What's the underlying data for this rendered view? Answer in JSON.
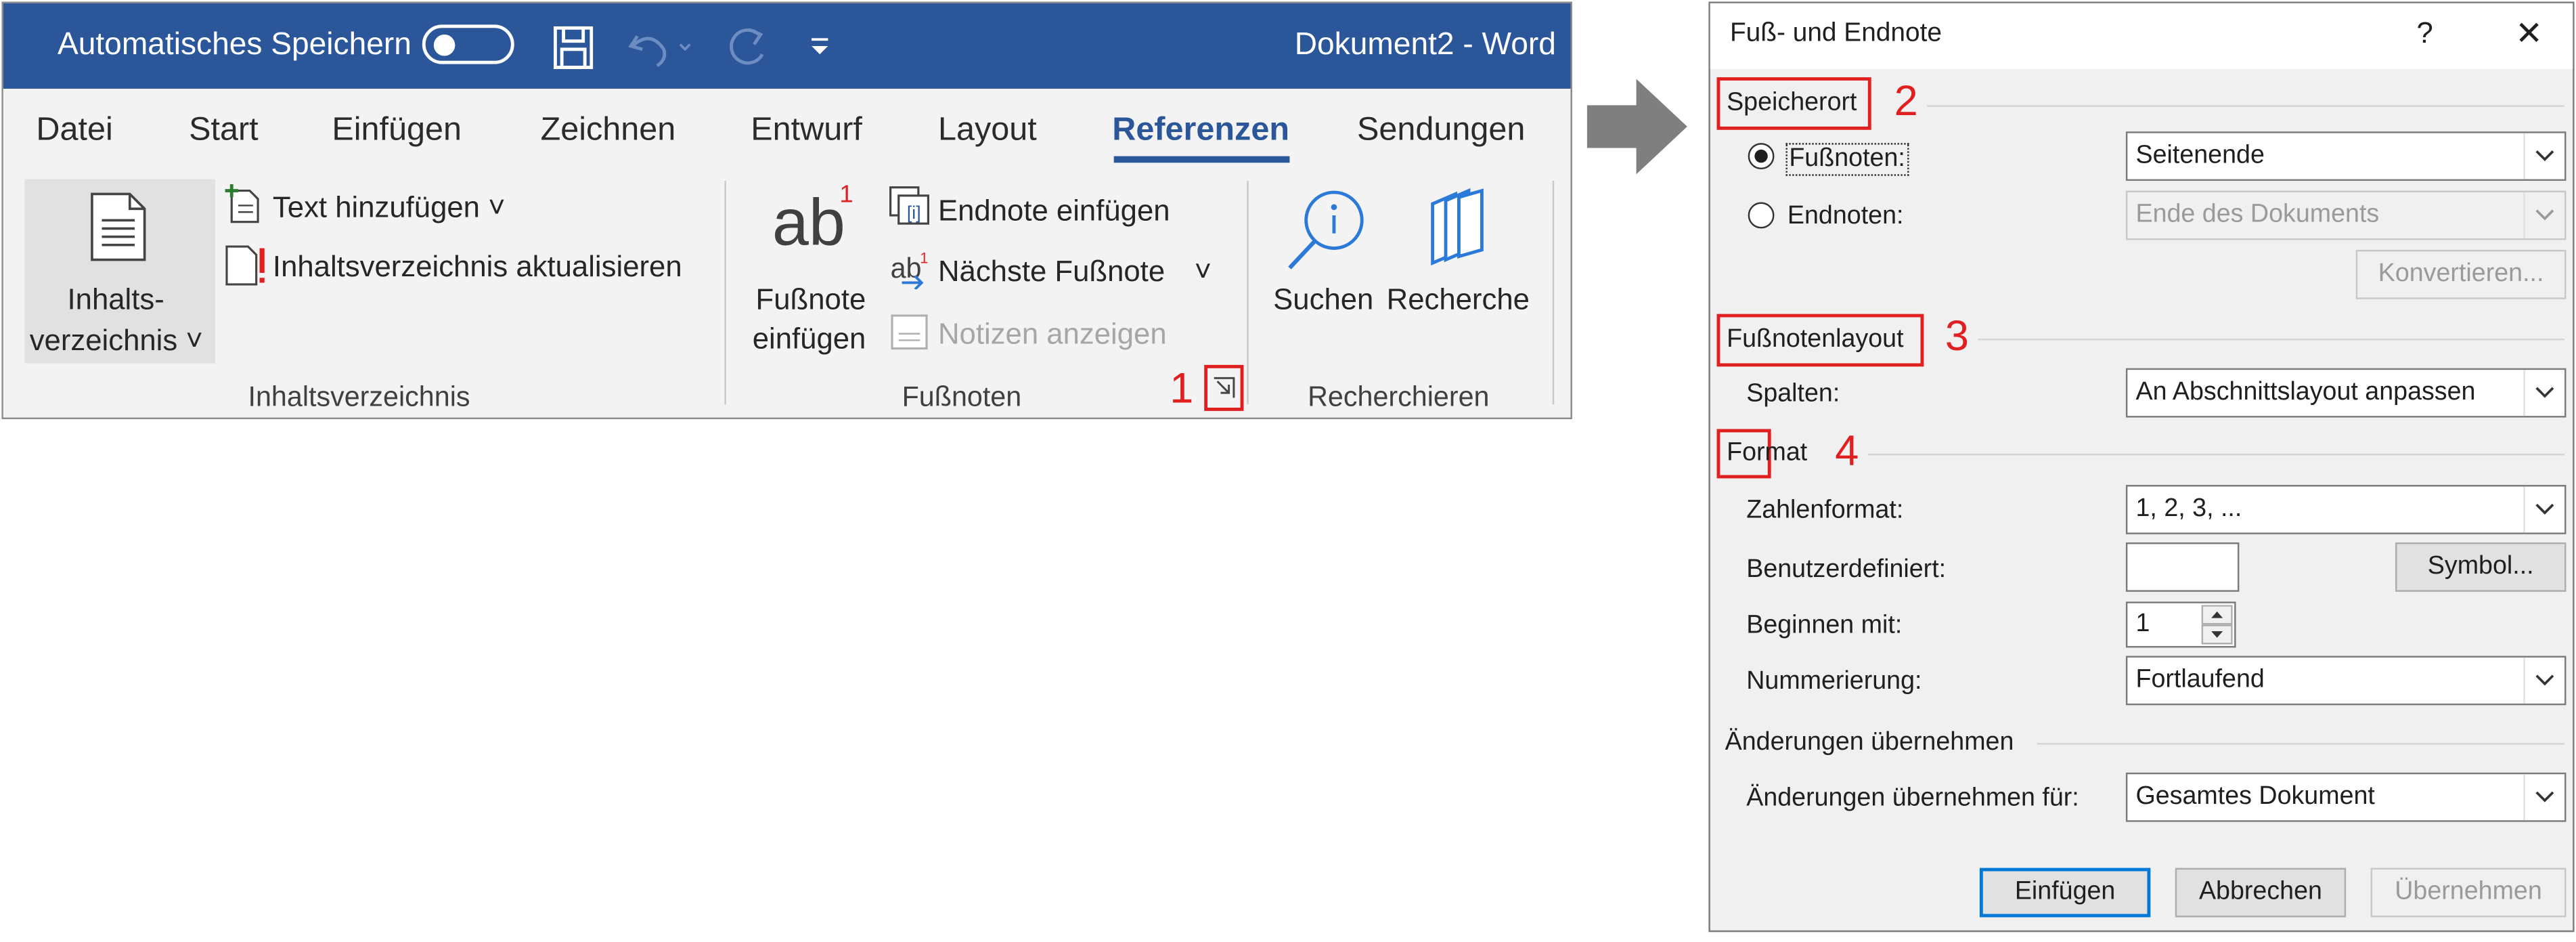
{
  "word": {
    "title_autosave": "Automatisches Speichern",
    "doc_title": "Dokument2  -  Word",
    "tabs": [
      "Datei",
      "Start",
      "Einfügen",
      "Zeichnen",
      "Entwurf",
      "Layout",
      "Referenzen",
      "Sendungen"
    ],
    "selected_tab": "Referenzen",
    "toc": {
      "button_line1": "Inhalts-",
      "button_line2": "verzeichnis ˅",
      "add_text": "Text hinzufügen ˅",
      "update_toc": "Inhaltsverzeichnis aktualisieren",
      "group_label": "Inhaltsverzeichnis"
    },
    "footnotes": {
      "insert_line1": "Fußnote",
      "insert_line2": "einfügen",
      "icon_text": "ab",
      "icon_superscript": "1",
      "insert_endnote": "Endnote einfügen",
      "next_footnote": "Nächste Fußnote",
      "next_chevron": "˅",
      "show_notes": "Notizen anzeigen",
      "group_label": "Fußnoten",
      "marker": "1"
    },
    "research": {
      "search": "Suchen",
      "researcher": "Recherche",
      "group_label": "Recherchieren"
    }
  },
  "dialog": {
    "title": "Fuß- und Endnote",
    "help": "?",
    "close": "✕",
    "location": {
      "heading": "Speicherort",
      "marker": "2",
      "footnotes_label": "Fußnoten:",
      "footnotes_value": "Seitenende",
      "endnotes_label": "Endnoten:",
      "endnotes_value": "Ende des Dokuments",
      "convert_button": "Konvertieren...",
      "selected": "footnotes"
    },
    "layout": {
      "heading": "Fußnotenlayout",
      "marker": "3",
      "columns_label": "Spalten:",
      "columns_value": "An Abschnittslayout anpassen"
    },
    "format": {
      "heading": "Format",
      "marker": "4",
      "number_format_label": "Zahlenformat:",
      "number_format_value": "1, 2, 3, ...",
      "custom_label": "Benutzerdefiniert:",
      "custom_value": "",
      "symbol_button": "Symbol...",
      "start_label": "Beginnen mit:",
      "start_value": "1",
      "numbering_label": "Nummerierung:",
      "numbering_value": "Fortlaufend"
    },
    "apply": {
      "heading": "Änderungen übernehmen",
      "apply_to_label": "Änderungen übernehmen für:",
      "apply_to_value": "Gesamtes Dokument"
    },
    "buttons": {
      "insert": "Einfügen",
      "cancel": "Abbrechen",
      "apply": "Übernehmen"
    }
  },
  "colors": {
    "word_blue": "#2b579a",
    "annotation_red": "#e02020",
    "dialog_bg": "#f0f0f0",
    "focus_blue": "#0078d7"
  }
}
